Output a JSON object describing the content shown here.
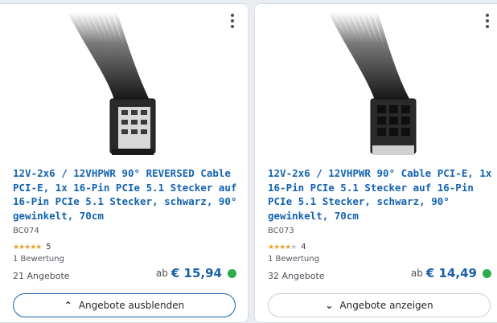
{
  "products": [
    {
      "title": "12V-2x6 / 12VHPWR 90° REVERSED Cable PCI-E, 1x 16-Pin PCIe 5.1 Stecker auf 16-Pin PCIe 5.1 Stecker, schwarz, 90° gewinkelt, 70cm",
      "sku": "BC074",
      "rating_stars": 5,
      "rating_count": "5",
      "reviews_label": "1 Bewertung",
      "offers_label": "21 Angebote",
      "price_prefix": "ab",
      "price": "€ 15,94",
      "availability_color": "#2eab4b",
      "button_label": "Angebote ausblenden",
      "button_icon": "chevron-up-icon"
    },
    {
      "title": "12V-2x6 / 12VHPWR 90° Cable PCI-E, 1x 16-Pin PCIe 5.1 Stecker auf 16-Pin PCIe 5.1 Stecker, schwarz, 90° gewinkelt, 70cm",
      "sku": "BC073",
      "rating_stars": 4,
      "rating_count": "4",
      "reviews_label": "1 Bewertung",
      "offers_label": "32 Angebote",
      "price_prefix": "ab",
      "price": "€ 14,49",
      "availability_color": "#2eab4b",
      "button_label": "Angebote anzeigen",
      "button_icon": "chevron-down-icon"
    }
  ],
  "glyphs": {
    "chevron_up": "⌃",
    "chevron_down": "⌄",
    "star": "★"
  }
}
